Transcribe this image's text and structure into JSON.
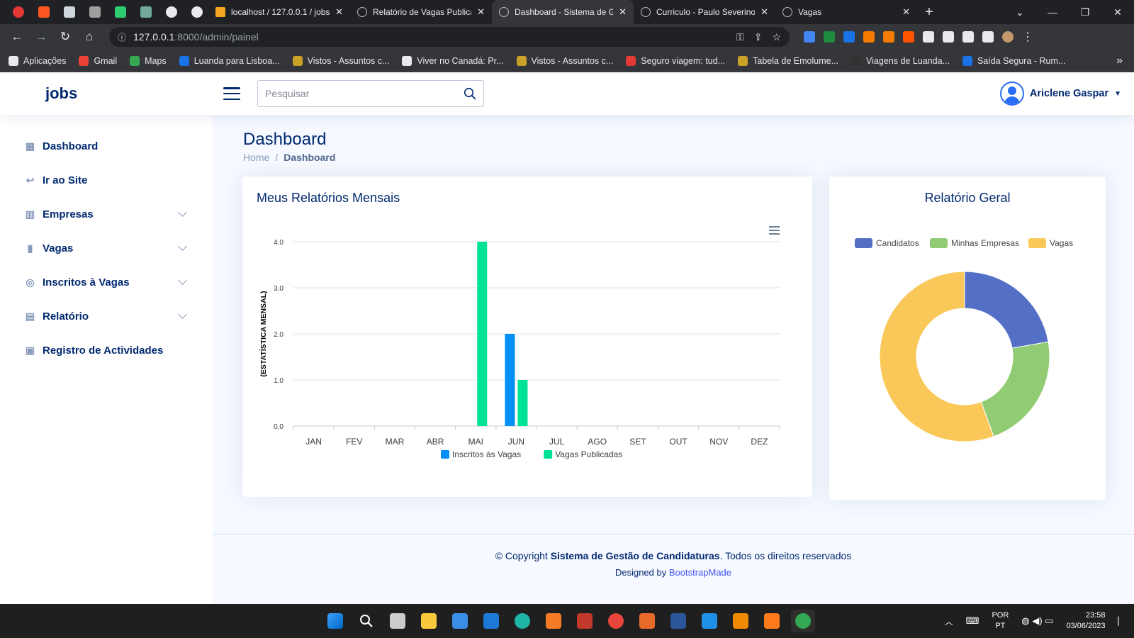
{
  "browser": {
    "tabs": [
      {
        "label": "localhost / 127.0.0.1 / jobs"
      },
      {
        "label": "Relatório de Vagas Publicadas"
      },
      {
        "label": "Dashboard - Sistema de Gestão",
        "active": true
      },
      {
        "label": "Curriculo - Paulo Severino"
      },
      {
        "label": "Vagas"
      }
    ],
    "url_host": "127.0.0.1",
    "url_rest": ":8000/admin/painel",
    "bookmarks": [
      {
        "label": "Aplicações",
        "color": "#e8eaed"
      },
      {
        "label": "Gmail",
        "color": "#ea4335"
      },
      {
        "label": "Maps",
        "color": "#34a853"
      },
      {
        "label": "Luanda para Lisboa...",
        "color": "#1a73e8"
      },
      {
        "label": "Vistos - Assuntos c...",
        "color": "#c9a227"
      },
      {
        "label": "Viver no Canadá: Pr...",
        "color": "#e8eaed"
      },
      {
        "label": "Vistos - Assuntos c...",
        "color": "#c9a227"
      },
      {
        "label": "Seguro viagem: tud...",
        "color": "#e53935"
      },
      {
        "label": "Tabela de Emolume...",
        "color": "#c9a227"
      },
      {
        "label": "Viagens de Luanda...",
        "color": "#333333"
      },
      {
        "label": "Saída Segura - Rum...",
        "color": "#1a73e8"
      }
    ]
  },
  "header": {
    "logo": "jobs",
    "search_placeholder": "Pesquisar",
    "user_name": "Ariclene Gaspar"
  },
  "sidebar": {
    "items": [
      {
        "label": "Dashboard",
        "icon": "grid-icon",
        "glyph": "▦",
        "has_children": false
      },
      {
        "label": "Ir ao Site",
        "icon": "reply-icon",
        "glyph": "↩",
        "has_children": false
      },
      {
        "label": "Empresas",
        "icon": "building-icon",
        "glyph": "▥",
        "has_children": true
      },
      {
        "label": "Vagas",
        "icon": "door-icon",
        "glyph": "▮",
        "has_children": true
      },
      {
        "label": "Inscritos à Vagas",
        "icon": "target-icon",
        "glyph": "◎",
        "has_children": true
      },
      {
        "label": "Relatório",
        "icon": "document-icon",
        "glyph": "▤",
        "has_children": true
      },
      {
        "label": "Registro de Actividades",
        "icon": "calendar-icon",
        "glyph": "▣",
        "has_children": false
      }
    ]
  },
  "page": {
    "title": "Dashboard",
    "breadcrumb": {
      "home": "Home",
      "separator": "/",
      "current": "Dashboard"
    }
  },
  "monthly_card": {
    "title": "Meus Relatórios Mensais"
  },
  "general_card": {
    "title": "Relatório Geral"
  },
  "chart_data": [
    {
      "type": "bar",
      "title": "Meus Relatórios Mensais",
      "xlabel": "",
      "ylabel": "(ESTATÍSTICA MENSAL)",
      "ylim": [
        0,
        4
      ],
      "yticks": [
        "0.0",
        "1.0",
        "2.0",
        "3.0",
        "4.0"
      ],
      "categories": [
        "JAN",
        "FEV",
        "MAR",
        "ABR",
        "MAI",
        "JUN",
        "JUL",
        "AGO",
        "SET",
        "OUT",
        "NOV",
        "DEZ"
      ],
      "series": [
        {
          "name": "Inscritos às Vagas",
          "color": "#008ffb",
          "values": [
            0,
            0,
            0,
            0,
            0,
            2,
            0,
            0,
            0,
            0,
            0,
            0
          ]
        },
        {
          "name": "Vagas Publicadas",
          "color": "#00e396",
          "values": [
            0,
            0,
            0,
            0,
            4,
            1,
            0,
            0,
            0,
            0,
            0,
            0
          ]
        }
      ],
      "grid": true,
      "legend": "bottom"
    },
    {
      "type": "pie",
      "title": "Relatório Geral",
      "legend": "top",
      "slices": [
        {
          "name": "Candidatos",
          "color": "#5470c6",
          "value": 2
        },
        {
          "name": "Minhas Empresas",
          "color": "#91cc75",
          "value": 2
        },
        {
          "name": "Vagas",
          "color": "#fac858",
          "value": 5
        }
      ]
    }
  ],
  "footer": {
    "copyright_prefix": "© Copyright",
    "system_name": "Sistema de Gestão de Candidaturas",
    "copyright_suffix": ". Todos os direitos reservados",
    "designed_by": "Designed by",
    "designer": "BootstrapMade"
  },
  "taskbar": {
    "lang_top": "POR",
    "lang_bottom": "PT",
    "time": "23:58",
    "date": "03/06/2023"
  }
}
